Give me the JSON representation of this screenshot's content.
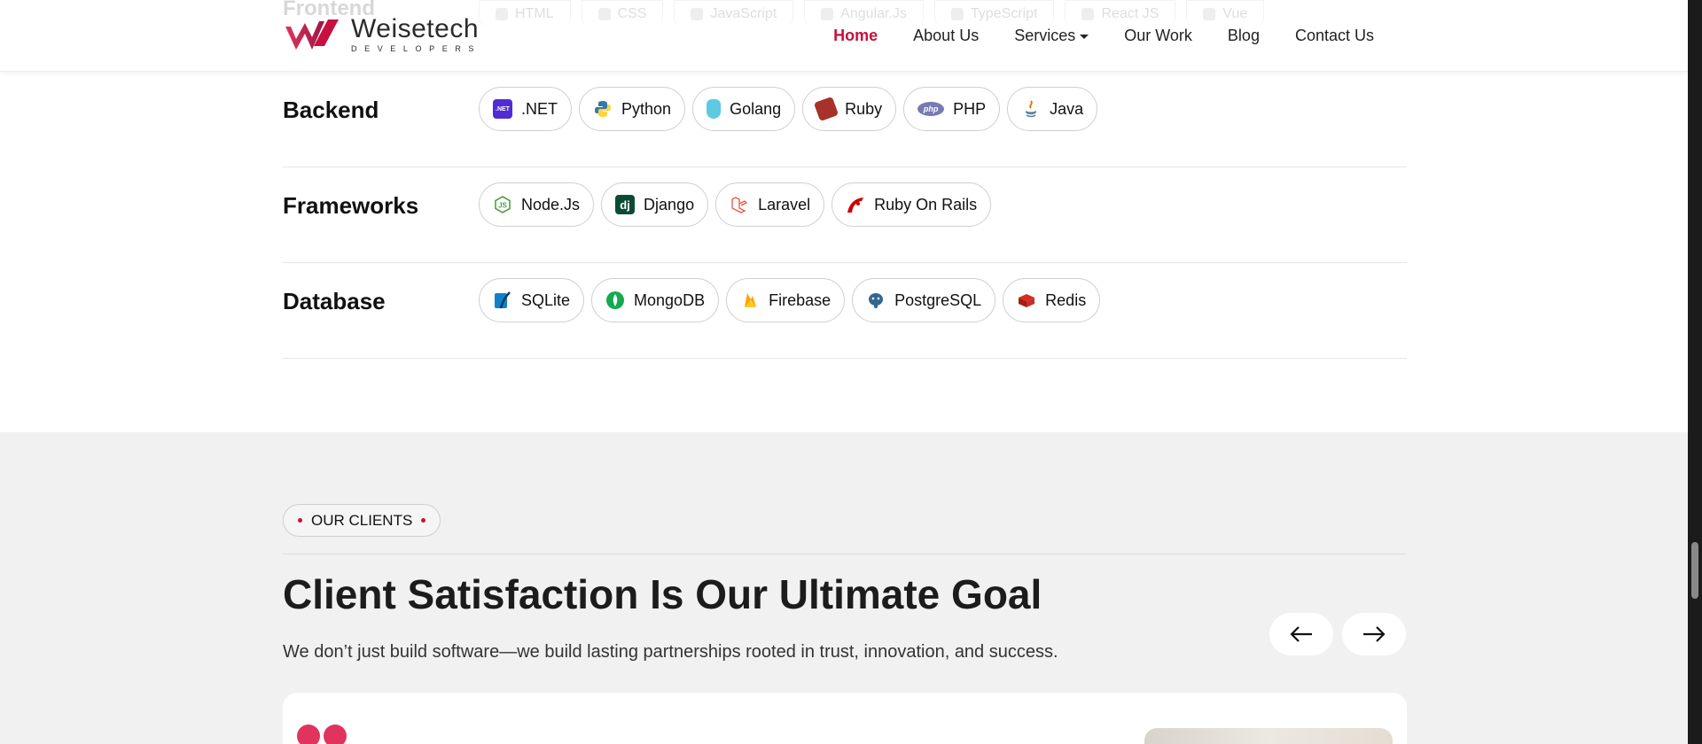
{
  "header": {
    "logo": {
      "brand": "Weisetech",
      "sub": "DEVELOPERS"
    },
    "ghost_heading": "Frontend",
    "ghost_pills": [
      "HTML",
      "CSS",
      "JavaScript",
      "Angular.Js",
      "TypeScript",
      "React JS",
      "Vue"
    ],
    "nav": {
      "home": "Home",
      "about": "About Us",
      "services": "Services",
      "work": "Our Work",
      "blog": "Blog",
      "contact": "Contact Us"
    },
    "accent_color": "#c8103e"
  },
  "tech": {
    "backend": {
      "title": "Backend",
      "items": [
        {
          "label": ".NET",
          "icon": "dotnet-icon",
          "color": "#512bd4"
        },
        {
          "label": "Python",
          "icon": "python-icon",
          "color": "#3776ab"
        },
        {
          "label": "Golang",
          "icon": "golang-icon",
          "color": "#5dc9e2"
        },
        {
          "label": "Ruby",
          "icon": "ruby-icon",
          "color": "#a8312a"
        },
        {
          "label": "PHP",
          "icon": "php-icon",
          "color": "#777bb3"
        },
        {
          "label": "Java",
          "icon": "java-icon",
          "color": "#e76f00"
        }
      ]
    },
    "frameworks": {
      "title": "Frameworks",
      "items": [
        {
          "label": "Node.Js",
          "icon": "nodejs-icon",
          "color": "#539e43"
        },
        {
          "label": "Django",
          "icon": "django-icon",
          "color": "#0c4b33"
        },
        {
          "label": "Laravel",
          "icon": "laravel-icon",
          "color": "#f05340"
        },
        {
          "label": "Ruby On Rails",
          "icon": "rails-icon",
          "color": "#cc0000"
        }
      ]
    },
    "database": {
      "title": "Database",
      "items": [
        {
          "label": "SQLite",
          "icon": "sqlite-icon",
          "color": "#0f80cc"
        },
        {
          "label": "MongoDB",
          "icon": "mongodb-icon",
          "color": "#13aa52"
        },
        {
          "label": "Firebase",
          "icon": "firebase-icon",
          "color": "#ffa000"
        },
        {
          "label": "PostgreSQL",
          "icon": "postgresql-icon",
          "color": "#336791"
        },
        {
          "label": "Redis",
          "icon": "redis-icon",
          "color": "#d82c20"
        }
      ]
    }
  },
  "clients": {
    "badge": "OUR CLIENTS",
    "title": "Client Satisfaction Is Our Ultimate Goal",
    "subtitle": "We don’t just build software—we build lasting partnerships rooted in trust, innovation, and success."
  }
}
